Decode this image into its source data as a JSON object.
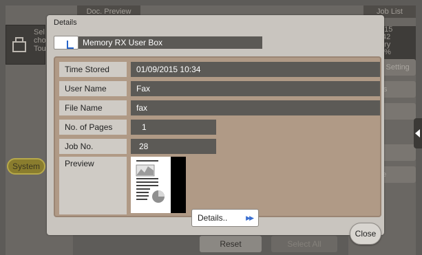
{
  "background": {
    "tabs": {
      "doc_preview": "Doc. Preview",
      "job_list": "Job List"
    },
    "message_lines": [
      "Sel",
      "cho",
      "Tou"
    ],
    "right_status_lines": [
      "015",
      ":42",
      "ory",
      "3%"
    ],
    "right_buttons": [
      "k Setting",
      "ils",
      "",
      "r",
      "te"
    ],
    "system_label": "System",
    "reset_label": "Reset",
    "select_all_label": "Select All"
  },
  "dialog": {
    "title": "Details",
    "box_name": "Memory RX User Box",
    "rows": [
      {
        "label": "Time Stored",
        "value": "01/09/2015 10:34"
      },
      {
        "label": "User Name",
        "value": "Fax"
      },
      {
        "label": "File Name",
        "value": "fax"
      },
      {
        "label": "No. of Pages",
        "value": "1"
      },
      {
        "label": "Job No.",
        "value": "28"
      }
    ],
    "preview_label": "Preview",
    "details_button": "Details..",
    "details_arrow": "▶▶",
    "close_button": "Close"
  },
  "icons": {
    "box": "user-box-icon",
    "preview": "document-thumbnail",
    "side": "collapse-arrow-icon"
  },
  "colors": {
    "dialog_bg": "#c9c5bf",
    "panel_bg": "#b09a86",
    "value_bg": "#5c5a56",
    "accent_blue": "#2563c9"
  }
}
